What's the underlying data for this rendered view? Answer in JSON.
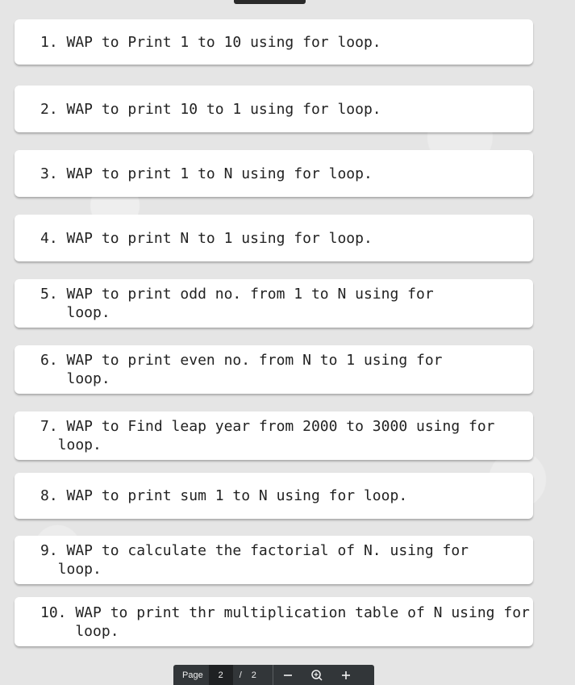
{
  "questions": [
    {
      "text": "1. WAP to Print 1 to 10 using for loop."
    },
    {
      "text": "2. WAP to print 10 to 1 using for loop."
    },
    {
      "text": "3. WAP to print 1 to N using for loop."
    },
    {
      "text": "4. WAP to print N to 1 using for loop."
    },
    {
      "text": "5. WAP to print odd no. from 1 to N using for\n   loop."
    },
    {
      "text": "6. WAP to print even no. from N to 1 using for\n   loop."
    },
    {
      "text": "7. WAP to Find leap year from 2000 to 3000 using for\n  loop."
    },
    {
      "text": "8. WAP to print sum 1 to N using for loop."
    },
    {
      "text": "9. WAP to calculate the factorial of N. using for\n  loop."
    },
    {
      "text": "10. WAP to print thr multiplication table of N using for\n    loop."
    }
  ],
  "toolbar": {
    "page_label": "Page",
    "current_page": "2",
    "separator": "/",
    "total_pages": "2",
    "zoom_out_icon": "minus-icon",
    "zoom_icon": "zoom-icon",
    "zoom_in_icon": "plus-icon"
  }
}
